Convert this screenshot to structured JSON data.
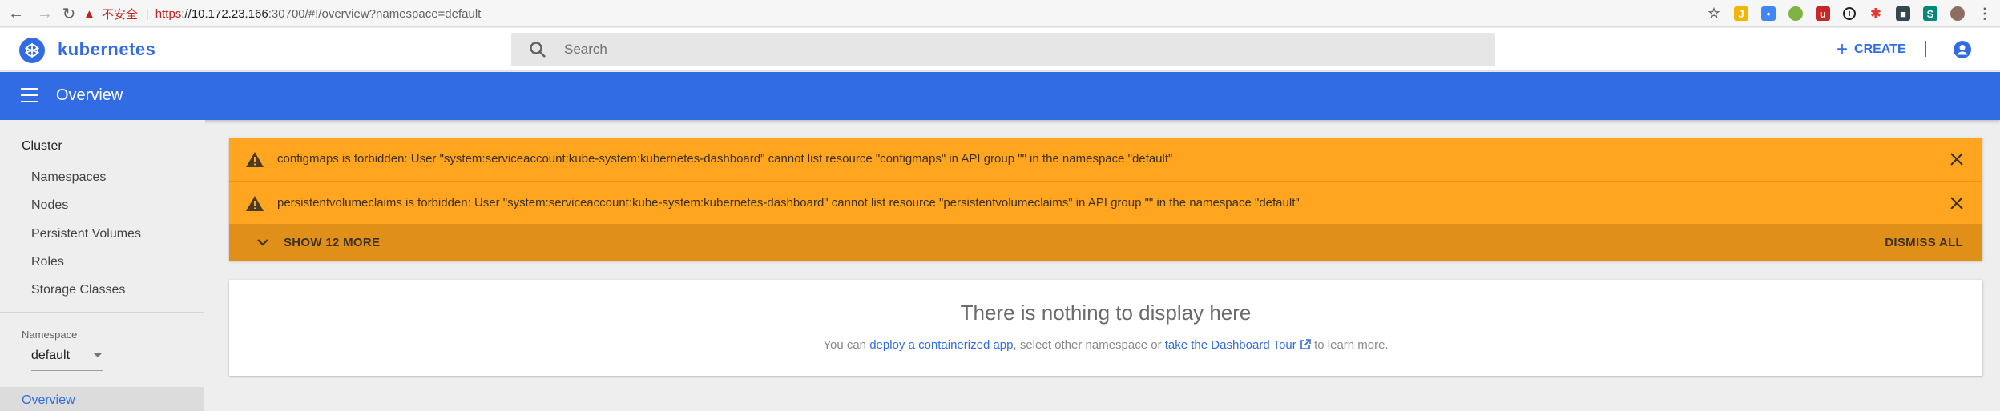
{
  "browser": {
    "security_label": "不安全",
    "url_scheme": "https",
    "url_host": "://10.172.23.166",
    "url_rest": ":30700/#!/overview?namespace=default"
  },
  "header": {
    "brand": "kubernetes",
    "search_placeholder": "Search",
    "create_label": "CREATE"
  },
  "toolbar": {
    "title": "Overview"
  },
  "sidebar": {
    "cluster_heading": "Cluster",
    "items": [
      {
        "label": "Namespaces"
      },
      {
        "label": "Nodes"
      },
      {
        "label": "Persistent Volumes"
      },
      {
        "label": "Roles"
      },
      {
        "label": "Storage Classes"
      }
    ],
    "namespace_label": "Namespace",
    "namespace_value": "default",
    "active_item": "Overview"
  },
  "notifications": {
    "items": [
      {
        "text": "configmaps is forbidden: User \"system:serviceaccount:kube-system:kubernetes-dashboard\" cannot list resource \"configmaps\" in API group \"\" in the namespace \"default\""
      },
      {
        "text": "persistentvolumeclaims is forbidden: User \"system:serviceaccount:kube-system:kubernetes-dashboard\" cannot list resource \"persistentvolumeclaims\" in API group \"\" in the namespace \"default\""
      }
    ],
    "show_more_label": "SHOW 12 MORE",
    "dismiss_all_label": "DISMISS ALL"
  },
  "empty_state": {
    "title": "There is nothing to display here",
    "prefix": "You can ",
    "deploy_link": "deploy a containerized app",
    "middle": ", select other namespace or ",
    "tour_link": "take the Dashboard Tour",
    "suffix": " to learn more."
  },
  "colors": {
    "brand_blue": "#326ce5",
    "warning_orange": "#ffa520",
    "warning_dark": "#e09019"
  }
}
